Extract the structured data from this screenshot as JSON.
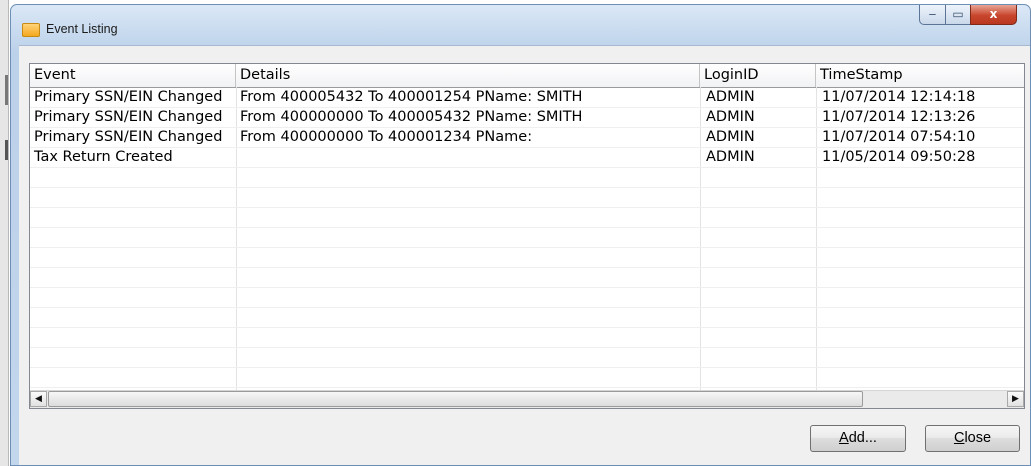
{
  "window": {
    "title": "Event Listing",
    "controls": {
      "minimize": "‒",
      "maximize": "▭",
      "close": "x"
    }
  },
  "grid": {
    "columns": [
      "Event",
      "Details",
      "LoginID",
      "TimeStamp"
    ],
    "rows": [
      [
        "Primary SSN/EIN Changed",
        "From 400005432 To 400001254 PName: SMITH",
        "ADMIN",
        "11/07/2014 12:14:18"
      ],
      [
        "Primary SSN/EIN Changed",
        "From 400000000 To 400005432 PName: SMITH",
        "ADMIN",
        "11/07/2014 12:13:26"
      ],
      [
        "Primary SSN/EIN Changed",
        "From 400000000 To 400001234 PName:",
        "ADMIN",
        "11/07/2014 07:54:10"
      ],
      [
        "Tax Return Created",
        "",
        "ADMIN",
        "11/05/2014 09:50:28"
      ]
    ],
    "scrollbar": {
      "left_arrow": "◀",
      "right_arrow": "▶"
    }
  },
  "buttons": {
    "add": {
      "mnemonic": "A",
      "rest": "dd..."
    },
    "close": {
      "mnemonic": "C",
      "rest": "lose"
    }
  }
}
